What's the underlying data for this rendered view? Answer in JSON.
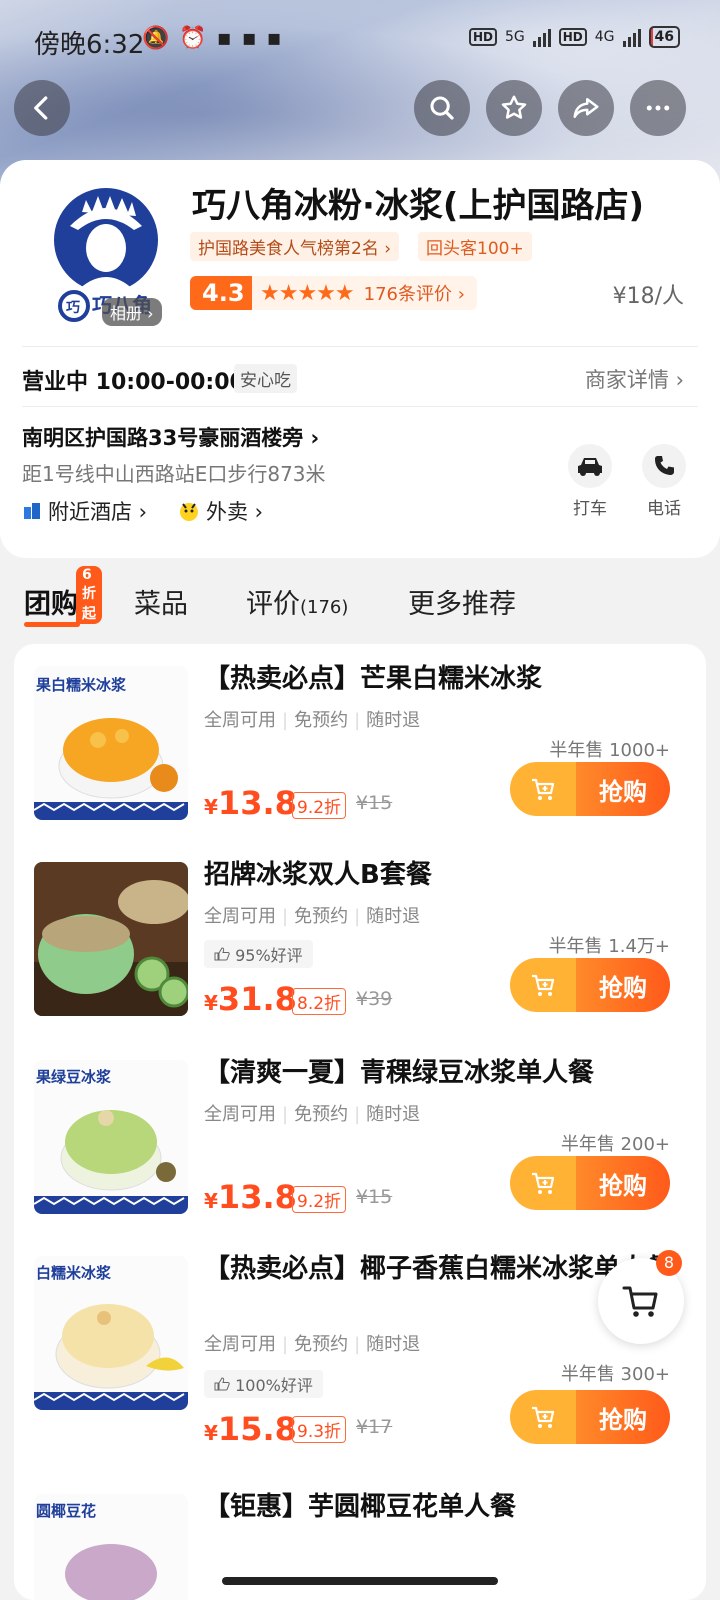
{
  "status_bar": {
    "time": "傍晚6:32",
    "network_1": "5G",
    "network_2": "4G",
    "hd": "HD",
    "battery": "46"
  },
  "nav": {
    "back_icon": "back-arrow-icon",
    "search_icon": "search-icon",
    "favorite_icon": "star-icon",
    "share_icon": "share-icon",
    "more_icon": "more-icon"
  },
  "shop": {
    "name": "巧八角冰粉·冰浆(上护国路店)",
    "logo_text": "巧八角",
    "album_tag": "相册 ›",
    "rank_badge": "护国路美食人气榜第2名 ›",
    "return_badge": "回头客100+",
    "score": "4.3",
    "stars": "★★★★★",
    "reviews_link": "176条评价 ›",
    "per_person": "¥18/人",
    "status": "营业中 10:00-00:00",
    "safe_tag": "安心吃",
    "merchant_detail": "商家详情 ›",
    "address": "南明区护国路33号豪丽酒楼旁 ›",
    "distance": "距1号线中山西路站E口步行873米",
    "nearby_hotel": "附近酒店 ›",
    "takeout": "外卖 ›",
    "taxi_label": "打车",
    "phone_label": "电话"
  },
  "tabs": {
    "group_buy": "团购",
    "group_buy_bubble": "6折起",
    "dishes": "菜品",
    "reviews": "评价",
    "reviews_count": "(176)",
    "more": "更多推荐"
  },
  "deals": [
    {
      "title": "【热卖必点】芒果白糯米冰浆",
      "tags": [
        "全周可用",
        "免预约",
        "随时退"
      ],
      "good_rate": "",
      "sold": "半年售 1000+",
      "yen": "¥",
      "price": "13.8",
      "discount": "9.2折",
      "original": "¥15",
      "buy_label": "抢购",
      "img_label": "果白糯米冰浆"
    },
    {
      "title": "招牌冰浆双人B套餐",
      "tags": [
        "全周可用",
        "免预约",
        "随时退"
      ],
      "good_rate": "95%好评",
      "sold": "半年售 1.4万+",
      "yen": "¥",
      "price": "31.8",
      "discount": "8.2折",
      "original": "¥39",
      "buy_label": "抢购",
      "img_label": ""
    },
    {
      "title": "【清爽一夏】青稞绿豆冰浆单人餐",
      "tags": [
        "全周可用",
        "免预约",
        "随时退"
      ],
      "good_rate": "",
      "sold": "半年售 200+",
      "yen": "¥",
      "price": "13.8",
      "discount": "9.2折",
      "original": "¥15",
      "buy_label": "抢购",
      "img_label": "果绿豆冰浆"
    },
    {
      "title": "【热卖必点】椰子香蕉白糯米冰浆单人餐",
      "tags": [
        "全周可用",
        "免预约",
        "随时退"
      ],
      "good_rate": "100%好评",
      "sold": "半年售 300+",
      "yen": "¥",
      "price": "15.8",
      "discount": "9.3折",
      "original": "¥17",
      "buy_label": "抢购",
      "img_label": "白糯米冰浆"
    },
    {
      "title": "【钜惠】芋圆椰豆花单人餐",
      "img_label": "圆椰豆花"
    }
  ],
  "cart": {
    "count": "8",
    "icon": "cart-icon"
  },
  "colors": {
    "accent": "#ff5a1a",
    "price": "#ff4d1f",
    "buy_cart": "#ffb233",
    "logo_blue": "#1f3f9a"
  }
}
